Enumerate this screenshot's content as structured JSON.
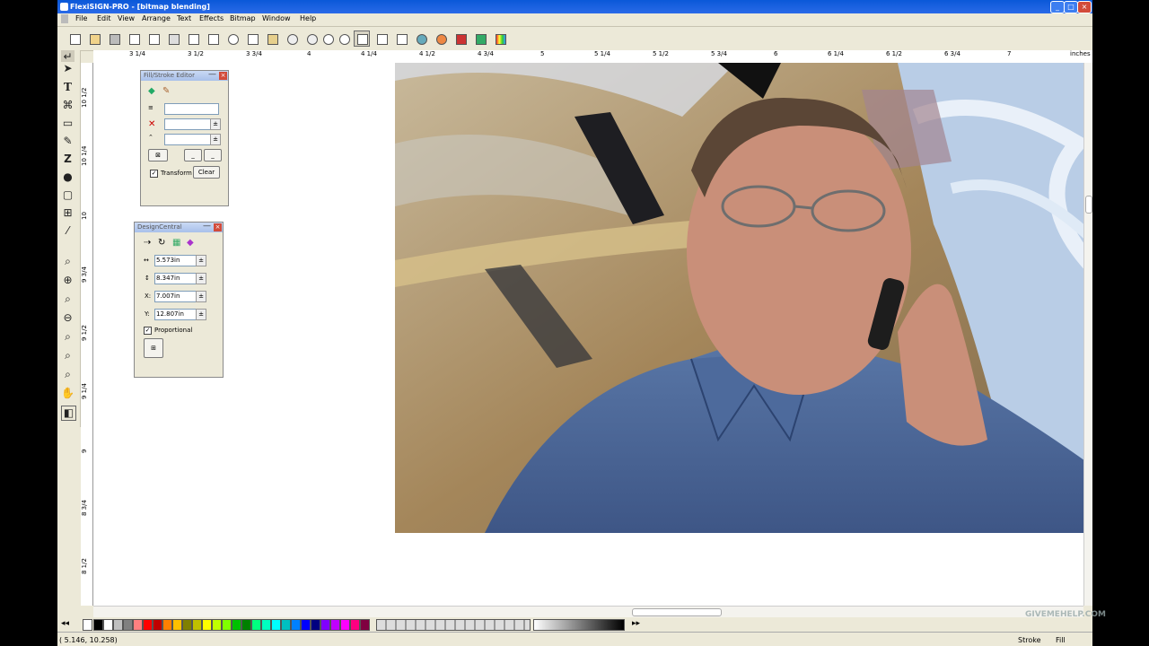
{
  "window": {
    "title": "FlexiSIGN-PRO - [bitmap blending]"
  },
  "menu": [
    "File",
    "Edit",
    "View",
    "Arrange",
    "Text",
    "Effects",
    "Bitmap",
    "Window",
    "Help"
  ],
  "ruler": {
    "unit": "inches",
    "h_labels": [
      "3 1/4",
      "3 1/2",
      "3 3/4",
      "4",
      "4 1/4",
      "4 1/2",
      "4 3/4",
      "5",
      "5 1/4",
      "5 1/2",
      "5 3/4",
      "6",
      "6 1/4",
      "6 1/2",
      "6 3/4",
      "7"
    ],
    "v_labels": [
      "10 1/2",
      "10 1/4",
      "10",
      "9 3/4",
      "9 1/2",
      "9 1/4",
      "9",
      "8 3/4",
      "8 1/2"
    ]
  },
  "fill_stroke_editor": {
    "title": "Fill/Stroke Editor",
    "transform_label": "Transform",
    "transform_checked": true,
    "clear_label": "Clear"
  },
  "design_central": {
    "title": "DesignCentral",
    "width": "5.573in",
    "height": "8.347in",
    "x_label": "X:",
    "x": "7.007in",
    "y_label": "Y:",
    "y": "12.807in",
    "proportional_label": "Proportional",
    "proportional_checked": true
  },
  "status": {
    "coords": "( 5.146, 10.258)",
    "stroke_label": "Stroke",
    "fill_label": "Fill"
  },
  "watermark": "GIVEMEHELP.COM",
  "palette": [
    "#000000",
    "#ffffff",
    "#c0c0c0",
    "#808080",
    "#ff8080",
    "#ff0000",
    "#c00000",
    "#ff8000",
    "#ffc000",
    "#808000",
    "#c0c000",
    "#ffff00",
    "#c0ff00",
    "#80ff00",
    "#00c000",
    "#008000",
    "#00ff80",
    "#00ffc0",
    "#00ffff",
    "#00c0c0",
    "#0080ff",
    "#0000ff",
    "#000080",
    "#8000ff",
    "#c000ff",
    "#ff00ff",
    "#ff0080",
    "#800040"
  ]
}
